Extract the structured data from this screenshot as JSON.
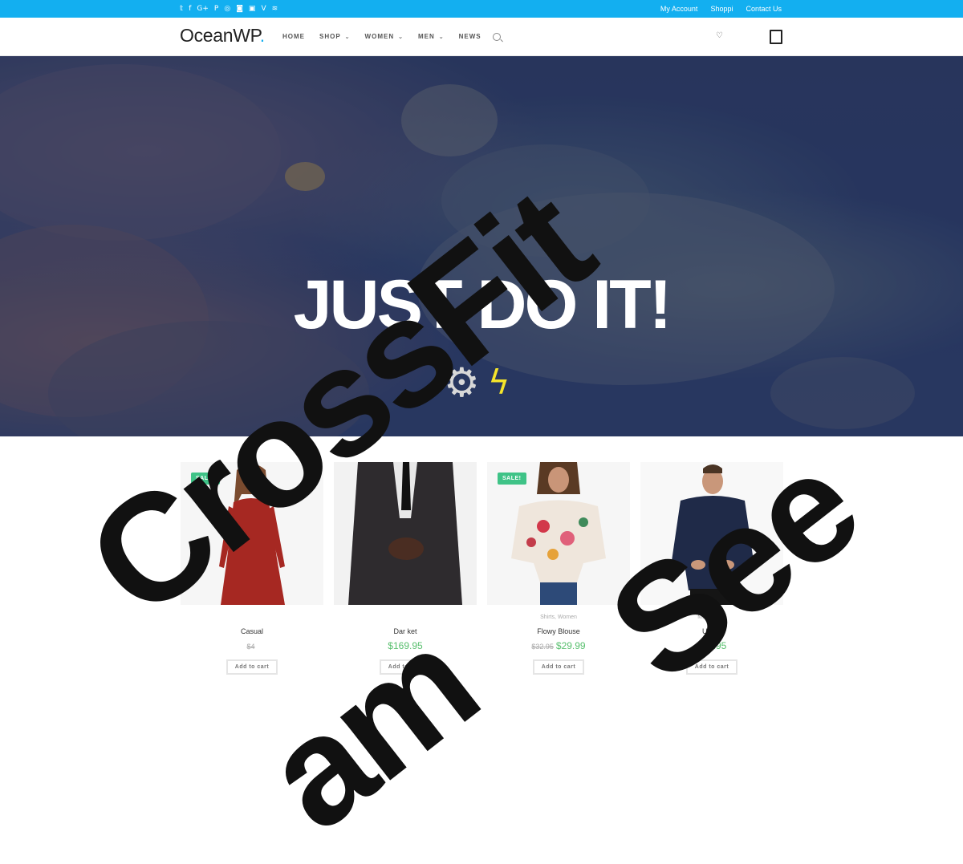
{
  "topbar": {
    "social_icons": [
      "twitter-icon",
      "facebook-icon",
      "google-plus-icon",
      "pinterest-icon",
      "dribbble-icon",
      "instagram-icon",
      "youtube-icon",
      "vimeo-icon",
      "rss-icon"
    ],
    "social_glyphs": [
      "𝕥",
      "f",
      "G+",
      "P",
      "◎",
      "◙",
      "▣",
      "V",
      "≋"
    ],
    "links": [
      "My Account",
      "Shoppi",
      "Contact Us"
    ],
    "color": "#13aff0"
  },
  "header": {
    "logo": "OceanWP",
    "logo_dot": ".",
    "nav": [
      "HOME",
      "SHOP",
      "WOMEN",
      "MEN",
      "NEWS"
    ]
  },
  "hero": {
    "title": "JUST DO IT!"
  },
  "products": [
    {
      "badge": "SALE!",
      "category": "",
      "name": "Casual",
      "old_price": "$4",
      "price": "",
      "button": "Add to cart"
    },
    {
      "badge": "",
      "category": "",
      "name": "Dar  ket",
      "old_price": "",
      "price": "$169.95",
      "button": "Add to cart"
    },
    {
      "badge": "SALE!",
      "category": "Shirts, Women",
      "name": "Flowy Blouse",
      "old_price": "$32.95",
      "price": "$29.99",
      "button": "Add to cart"
    },
    {
      "badge": "",
      "category": "Men, Shirts",
      "name": "Usher",
      "old_price": "",
      "price": "$74.95",
      "button": "Add to cart"
    }
  ],
  "watermark": {
    "words": [
      "CrossFit",
      "am",
      "See"
    ]
  }
}
